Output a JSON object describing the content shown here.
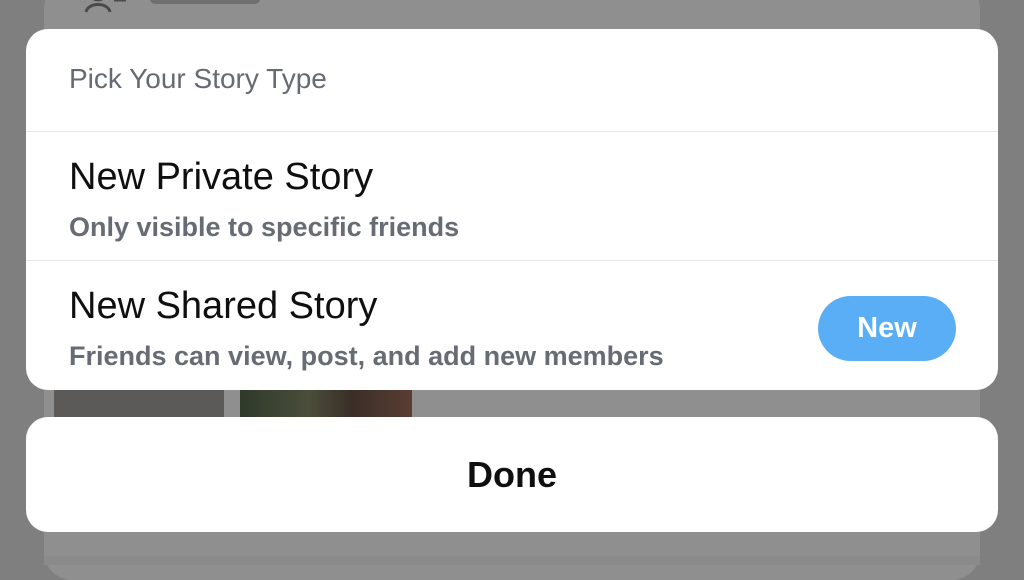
{
  "sheet": {
    "title": "Pick Your Story Type",
    "options": [
      {
        "title": "New Private Story",
        "subtitle": "Only visible to specific friends"
      },
      {
        "title": "New Shared Story",
        "subtitle": "Friends can view, post, and add new members",
        "badge": "New"
      }
    ]
  },
  "done_button": {
    "label": "Done"
  },
  "colors": {
    "badge_blue": "#5aaef5",
    "overlay_gray": "#7f7f7f",
    "text_primary": "#0f0f0f",
    "text_secondary": "#676c74"
  },
  "icons": {
    "background_top_left": "add-friend-icon"
  }
}
